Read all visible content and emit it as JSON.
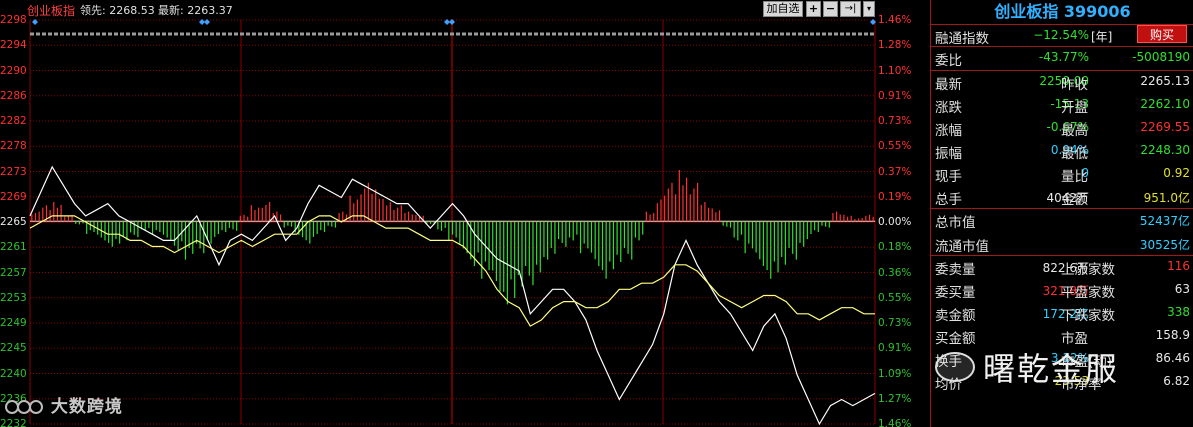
{
  "topbar": {
    "title": "创业板指",
    "lead_label": "领先: 2268.53",
    "last_label": "最新: 2263.37",
    "add_button": "加自选",
    "btn_plus": "+",
    "btn_minus": "−",
    "btn_last": "→|",
    "btn_menu": "▾"
  },
  "left_axis": [
    "2298",
    "2294",
    "2290",
    "2286",
    "2282",
    "2278",
    "2273",
    "2269",
    "2265",
    "2261",
    "2257",
    "2253",
    "2249",
    "2245",
    "2240",
    "2236",
    "2232"
  ],
  "right_axis": [
    "1.46%",
    "1.28%",
    "1.10%",
    "0.91%",
    "0.73%",
    "0.55%",
    "0.37%",
    "0.19%",
    "0.00%",
    "0.18%",
    "0.36%",
    "0.55%",
    "0.73%",
    "0.91%",
    "1.09%",
    "1.27%",
    "1.46%"
  ],
  "watermark_left": "大数跨境",
  "watermark_right": "曙乾金服",
  "colors": {
    "up": "#ff3030",
    "down": "#30e030",
    "grid": "#8b0000",
    "price_line": "#ffffff",
    "avg_line": "#ffff80"
  },
  "panel": {
    "title": "创业板指 399006",
    "buy_button": "购买",
    "rows": [
      {
        "l1": "融通指数",
        "v1": "−12.54%",
        "tag": "[年]"
      },
      {
        "l1": "委比",
        "v1": "-43.77%",
        "v2": "-5008190"
      },
      {
        "l1": "最新",
        "v1": "2250.00",
        "l2": "昨收",
        "v2": "2265.13"
      },
      {
        "l1": "涨跌",
        "v1": "-15.13",
        "l2": "开盘",
        "v2": "2262.10"
      },
      {
        "l1": "涨幅",
        "v1": "-0.67%",
        "l2": "最高",
        "v2": "2269.55"
      },
      {
        "l1": "振幅",
        "v1": "0.94%",
        "l2": "最低",
        "v2": "2248.30"
      },
      {
        "l1": "现手",
        "v1": "0",
        "l2": "量比",
        "v2": "0.92"
      },
      {
        "l1": "总手",
        "v1": "4042万",
        "l2": "金额",
        "v2": "951.0亿"
      },
      {
        "l1": "总市值",
        "v2": "52437亿"
      },
      {
        "l1": "流通市值",
        "v2": "30525亿"
      },
      {
        "l1": "委卖量",
        "v1": "822.6万",
        "l2": "上涨家数",
        "v2": "116"
      },
      {
        "l1": "委买量",
        "v1": "321.8万",
        "l2": "平盘家数",
        "v2": "63"
      },
      {
        "l1": "卖金额",
        "v1": "172.2亿",
        "l2": "下跌家数",
        "v2": "338"
      },
      {
        "l1": "买金额",
        "v1": "",
        "l2": "市盈",
        "v2": "158.9"
      },
      {
        "l1": "换手",
        "v1": "3.12%",
        "l2": "市盈(动)",
        "v2": "86.46"
      },
      {
        "l1": "均价",
        "v1": "23.53",
        "l2": "市净率",
        "v2": "6.82"
      }
    ]
  },
  "chart_data": {
    "type": "line",
    "title": "创业板指",
    "xlabel": "",
    "ylabel": "",
    "ylim": [
      2232,
      2298
    ],
    "prev_close": 2265.13,
    "series": [
      {
        "values": [
          2266,
          2270,
          2274,
          2271,
          2268,
          2266,
          2267,
          2268,
          2266,
          2265,
          2264,
          2263,
          2262,
          2262,
          2264,
          2266,
          2262,
          2258,
          2262,
          2263,
          2262,
          2264,
          2266,
          2262,
          2264,
          2268,
          2271,
          2270,
          2269,
          2272,
          2271,
          2270,
          2269,
          2268,
          2268,
          2266,
          2264,
          2266,
          2268,
          2266,
          2263,
          2261,
          2259,
          2258,
          2257,
          2250,
          2252,
          2254,
          2254,
          2252,
          2249,
          2244,
          2240,
          2236,
          2239,
          2242,
          2245,
          2250,
          2258,
          2262,
          2258,
          2255,
          2252,
          2250,
          2247,
          2244,
          2248,
          2250,
          2246,
          2240,
          2236,
          2232,
          2235,
          2236,
          2235,
          2236,
          2237
        ],
        "colorKey": "price_line"
      },
      {
        "values": [
          2264,
          2265,
          2266,
          2266,
          2266,
          2265,
          2264,
          2263,
          2263,
          2262,
          2262,
          2261,
          2261,
          2260,
          2261,
          2262,
          2261,
          2260,
          2261,
          2262,
          2261,
          2262,
          2263,
          2263,
          2263,
          2265,
          2266,
          2266,
          2265,
          2266,
          2266,
          2265,
          2264,
          2264,
          2264,
          2263,
          2262,
          2262,
          2262,
          2261,
          2259,
          2257,
          2254,
          2252,
          2251,
          2248,
          2249,
          2251,
          2252,
          2252,
          2251,
          2251,
          2252,
          2254,
          2254,
          2255,
          2255,
          2256,
          2258,
          2258,
          2257,
          2255,
          2253,
          2252,
          2251,
          2252,
          2253,
          2253,
          2252,
          2250,
          2250,
          2249,
          2250,
          2251,
          2251,
          2250,
          2250
        ],
        "colorKey": "avg_line"
      }
    ],
    "bars": [
      3,
      5,
      6,
      2,
      -1,
      -4,
      -6,
      -8,
      -7,
      -5,
      -3,
      -4,
      -6,
      -9,
      -12,
      -10,
      -7,
      -4,
      -3,
      2,
      5,
      6,
      3,
      -2,
      -5,
      -7,
      -4,
      -2,
      3,
      8,
      12,
      10,
      7,
      5,
      3,
      2,
      -1,
      -3,
      -6,
      -10,
      -14,
      -18,
      -22,
      -26,
      -24,
      -20,
      -16,
      -12,
      -8,
      -6,
      -10,
      -14,
      -18,
      -15,
      -12,
      -6,
      3,
      8,
      12,
      16,
      12,
      6,
      4,
      -2,
      -6,
      -10,
      -14,
      -18,
      -16,
      -12,
      -8,
      -4,
      -2,
      3,
      2,
      1,
      2
    ]
  }
}
